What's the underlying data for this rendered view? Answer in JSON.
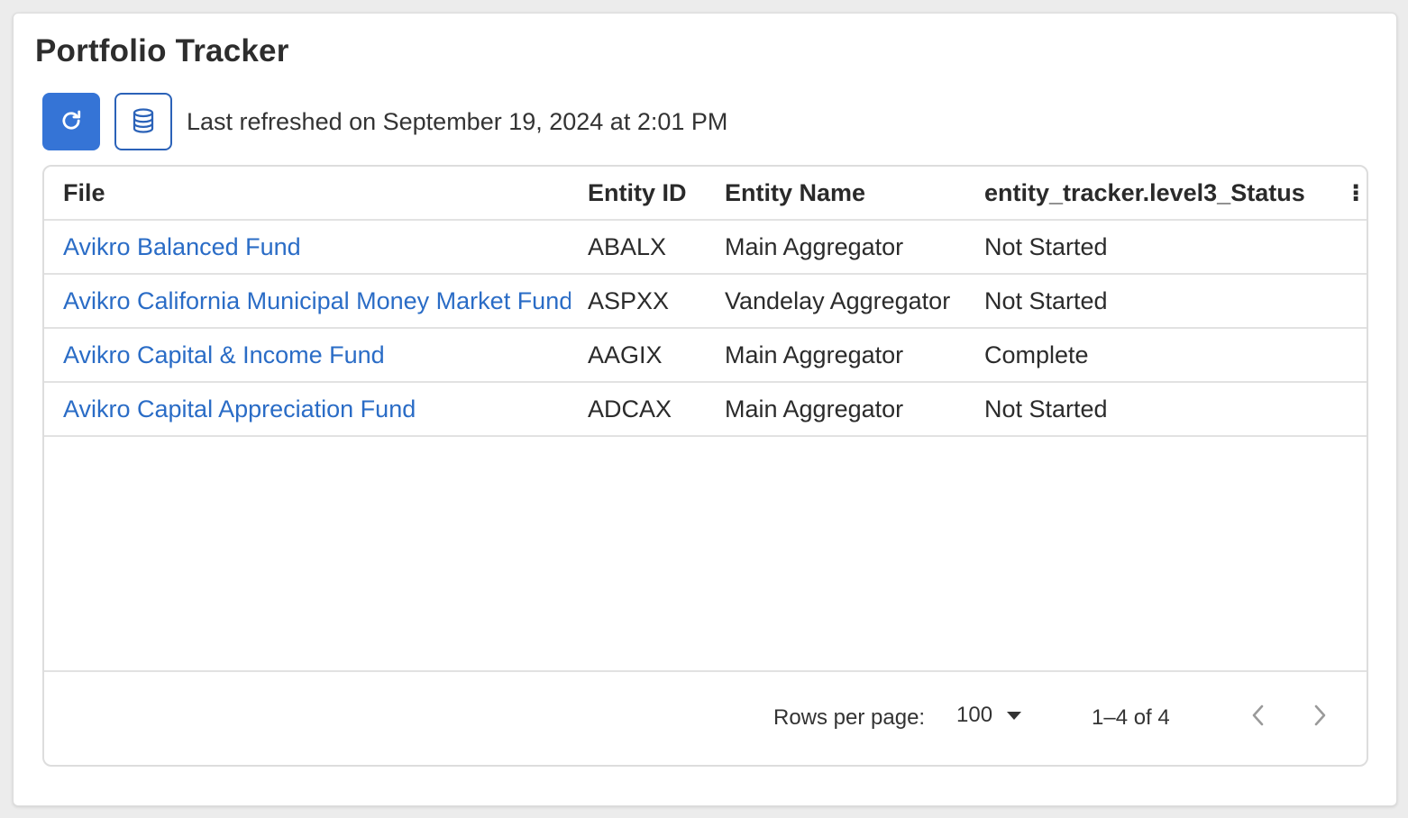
{
  "page": {
    "title": "Portfolio Tracker",
    "last_refreshed": "Last refreshed on September 19, 2024 at 2:01 PM"
  },
  "toolbar": {
    "refresh_icon": "refresh-icon",
    "database_icon": "database-icon"
  },
  "table": {
    "columns": [
      "File",
      "Entity ID",
      "Entity Name",
      "entity_tracker.level3_Status"
    ],
    "rows": [
      {
        "file": "Avikro Balanced Fund",
        "entity_id": "ABALX",
        "entity_name": "Main Aggregator",
        "status": "Not Started"
      },
      {
        "file": "Avikro California Municipal Money Market Fund",
        "entity_id": "ASPXX",
        "entity_name": "Vandelay Aggregator",
        "status": "Not Started"
      },
      {
        "file": "Avikro Capital & Income Fund",
        "entity_id": "AAGIX",
        "entity_name": "Main Aggregator",
        "status": "Complete"
      },
      {
        "file": "Avikro Capital Appreciation Fund",
        "entity_id": "ADCAX",
        "entity_name": "Main Aggregator",
        "status": "Not Started"
      }
    ]
  },
  "pagination": {
    "rows_per_page_label": "Rows per page:",
    "rows_per_page_value": "100",
    "range_text": "1–4 of 4"
  },
  "colors": {
    "accent": "#3574d6",
    "link": "#2a6cc6"
  }
}
